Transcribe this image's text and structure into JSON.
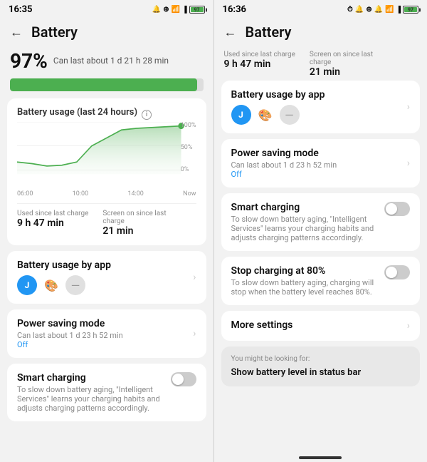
{
  "left": {
    "statusBar": {
      "time": "16:35",
      "batteryPercent": "97"
    },
    "title": "Battery",
    "batteryPercent": "97%",
    "canLast": "Can last about 1 d 21 h 28 min",
    "batteryBarWidth": "97%",
    "chartTitle": "Battery usage (last 24 hours)",
    "chartTimeLabels": [
      "06:00",
      "10:00",
      "14:00",
      "Now"
    ],
    "chartRightLabels": [
      "100%",
      "50%",
      "0%"
    ],
    "usedSinceLastCharge": {
      "label": "Used since last charge",
      "value": "9 h 47 min"
    },
    "screenOnSinceLastCharge": {
      "label": "Screen on since last charge",
      "value": "21 min"
    },
    "batteryUsageByApp": {
      "title": "Battery usage by app"
    },
    "powerSavingMode": {
      "title": "Power saving mode",
      "sub": "Can last about 1 d 23 h 52 min",
      "status": "Off"
    },
    "smartCharging": {
      "title": "Smart charging",
      "sub": "To slow down battery aging, \"Intelligent Services\" learns your charging habits and adjusts charging patterns accordingly."
    }
  },
  "right": {
    "statusBar": {
      "time": "16:36",
      "batteryPercent": "97"
    },
    "title": "Battery",
    "usedSinceLastCharge": {
      "label": "Used since last charge",
      "value": "9 h 47 min"
    },
    "screenOnSinceLastCharge": {
      "label": "Screen on since last\ncharge",
      "value": "21 min"
    },
    "batteryUsageByApp": {
      "title": "Battery usage by app"
    },
    "powerSavingMode": {
      "title": "Power saving mode",
      "sub": "Can last about 1 d 23 h 52 min",
      "status": "Off"
    },
    "smartCharging": {
      "title": "Smart charging",
      "sub": "To slow down battery aging, \"Intelligent Services\" learns your charging habits and adjusts charging patterns accordingly."
    },
    "stopCharging": {
      "title": "Stop charging at 80%",
      "sub": "To slow down battery aging, charging will stop when the battery level reaches 80%."
    },
    "moreSettings": {
      "title": "More settings"
    },
    "suggestion": {
      "label": "You might be looking for:",
      "item": "Show battery level in status bar"
    }
  }
}
